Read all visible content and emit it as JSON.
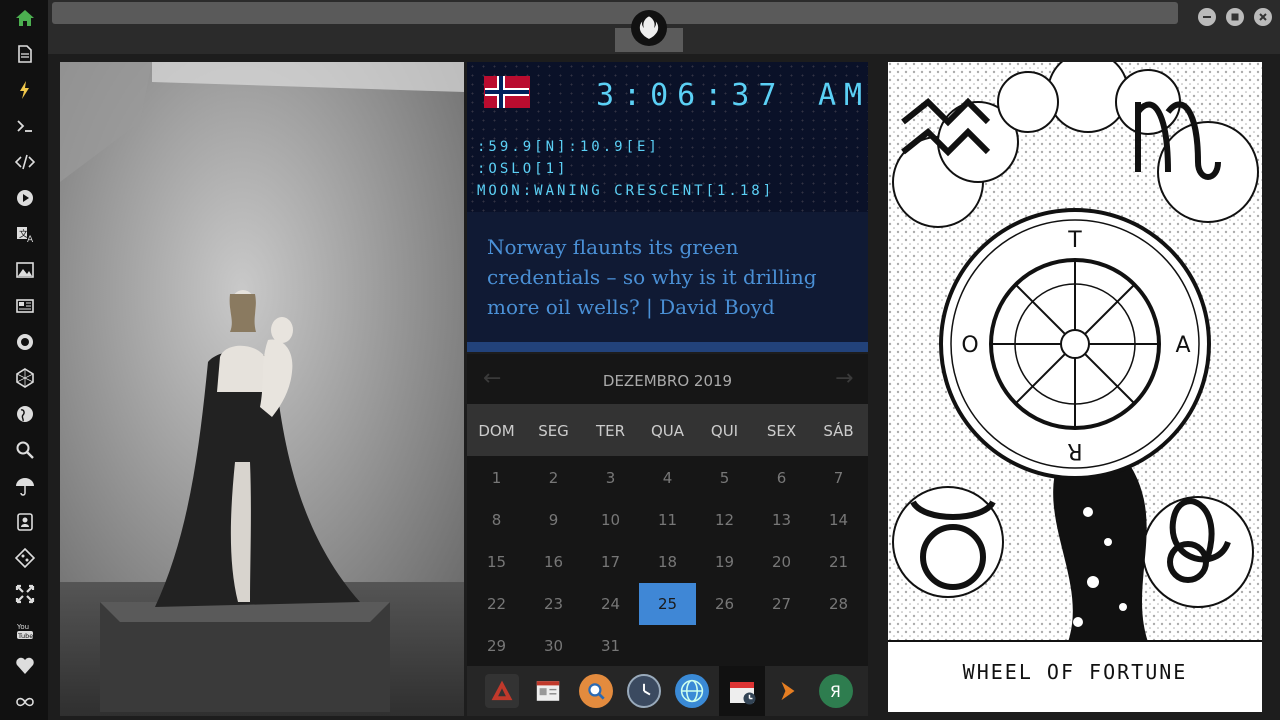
{
  "clock": {
    "time": "3:06:37",
    "ampm": "AM",
    "coords": ":59.9[N]:10.9[E]",
    "city": ":OSLO[1]",
    "moon": "MOON:WANING CRESCENT[1.18]"
  },
  "news": {
    "headline": "Norway flaunts its green credentials – so why is it drilling more oil wells? | David Boyd"
  },
  "calendar": {
    "month": "DEZEMBRO 2019",
    "prev_icon": "←",
    "next_icon": "→",
    "weekdays": [
      "DOM",
      "SEG",
      "TER",
      "QUA",
      "QUI",
      "SEX",
      "SÁB"
    ],
    "today": 25,
    "days": [
      [
        "1",
        "2",
        "3",
        "4",
        "5",
        "6",
        "7"
      ],
      [
        "8",
        "9",
        "10",
        "11",
        "12",
        "13",
        "14"
      ],
      [
        "15",
        "16",
        "17",
        "18",
        "19",
        "20",
        "21"
      ],
      [
        "22",
        "23",
        "24",
        "25",
        "26",
        "27",
        "28"
      ],
      [
        "29",
        "30",
        "31"
      ]
    ]
  },
  "tarot": {
    "label": "WHEEL OF FORTUNE"
  },
  "colors": {
    "accent_cyan": "#5bd0f5",
    "headline_blue": "#4a90d6",
    "today_blue": "#3f87d6",
    "home_green": "#4caf50"
  },
  "sidebar_icons": [
    "home-icon",
    "document-icon",
    "lightning-icon",
    "terminal-icon",
    "code-icon",
    "play-icon",
    "translate-icon",
    "image-icon",
    "news-icon",
    "rebel-icon",
    "hexagon-icon",
    "globe-icon",
    "search-icon",
    "umbrella-icon",
    "contact-icon",
    "git-icon",
    "expand-icon",
    "youtube-icon",
    "heart-icon",
    "infinity-icon"
  ],
  "dock_icons": [
    "arch-icon",
    "calendar-doc-icon",
    "search-icon",
    "clock-icon",
    "globe-icon",
    "calendar-icon",
    "arrow-icon",
    "yandex-icon"
  ]
}
